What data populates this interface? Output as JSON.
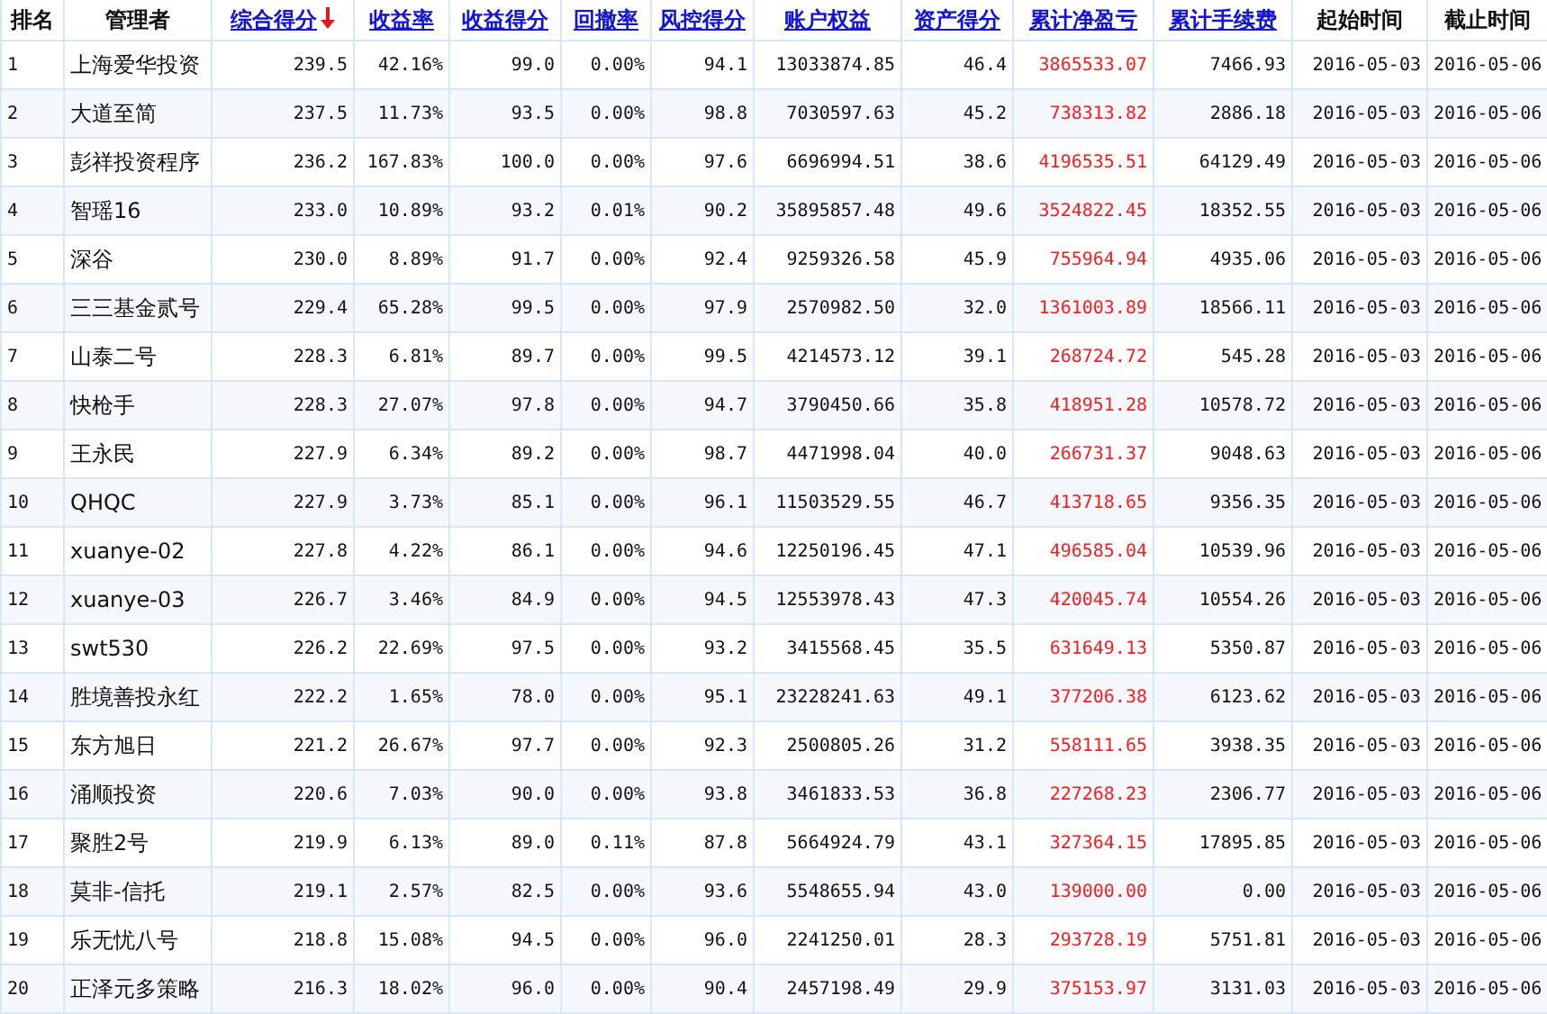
{
  "table": {
    "columns": [
      {
        "label": "排名",
        "sortable": false,
        "sorted": false,
        "negative_red": false
      },
      {
        "label": "管理者",
        "sortable": false,
        "sorted": false,
        "negative_red": false
      },
      {
        "label": "综合得分",
        "sortable": true,
        "sorted": true,
        "negative_red": false
      },
      {
        "label": "收益率",
        "sortable": true,
        "sorted": false,
        "negative_red": false
      },
      {
        "label": "收益得分",
        "sortable": true,
        "sorted": false,
        "negative_red": false
      },
      {
        "label": "回撤率",
        "sortable": true,
        "sorted": false,
        "negative_red": false
      },
      {
        "label": "风控得分",
        "sortable": true,
        "sorted": false,
        "negative_red": false
      },
      {
        "label": "账户权益",
        "sortable": true,
        "sorted": false,
        "negative_red": false
      },
      {
        "label": "资产得分",
        "sortable": true,
        "sorted": false,
        "negative_red": false
      },
      {
        "label": "累计净盈亏",
        "sortable": true,
        "sorted": false,
        "negative_red": true
      },
      {
        "label": "累计手续费",
        "sortable": true,
        "sorted": false,
        "negative_red": false
      },
      {
        "label": "起始时间",
        "sortable": false,
        "sorted": false,
        "negative_red": false
      },
      {
        "label": "截止时间",
        "sortable": false,
        "sorted": false,
        "negative_red": false
      }
    ],
    "rows": [
      [
        "1",
        "上海爱华投资",
        "239.5",
        "42.16%",
        "99.0",
        "0.00%",
        "94.1",
        "13033874.85",
        "46.4",
        "3865533.07",
        "7466.93",
        "2016-05-03",
        "2016-05-06"
      ],
      [
        "2",
        "大道至简",
        "237.5",
        "11.73%",
        "93.5",
        "0.00%",
        "98.8",
        "7030597.63",
        "45.2",
        "738313.82",
        "2886.18",
        "2016-05-03",
        "2016-05-06"
      ],
      [
        "3",
        "彭祥投资程序",
        "236.2",
        "167.83%",
        "100.0",
        "0.00%",
        "97.6",
        "6696994.51",
        "38.6",
        "4196535.51",
        "64129.49",
        "2016-05-03",
        "2016-05-06"
      ],
      [
        "4",
        "智瑶16",
        "233.0",
        "10.89%",
        "93.2",
        "0.01%",
        "90.2",
        "35895857.48",
        "49.6",
        "3524822.45",
        "18352.55",
        "2016-05-03",
        "2016-05-06"
      ],
      [
        "5",
        "深谷",
        "230.0",
        "8.89%",
        "91.7",
        "0.00%",
        "92.4",
        "9259326.58",
        "45.9",
        "755964.94",
        "4935.06",
        "2016-05-03",
        "2016-05-06"
      ],
      [
        "6",
        "三三基金贰号",
        "229.4",
        "65.28%",
        "99.5",
        "0.00%",
        "97.9",
        "2570982.50",
        "32.0",
        "1361003.89",
        "18566.11",
        "2016-05-03",
        "2016-05-06"
      ],
      [
        "7",
        "山泰二号",
        "228.3",
        "6.81%",
        "89.7",
        "0.00%",
        "99.5",
        "4214573.12",
        "39.1",
        "268724.72",
        "545.28",
        "2016-05-03",
        "2016-05-06"
      ],
      [
        "8",
        "快枪手",
        "228.3",
        "27.07%",
        "97.8",
        "0.00%",
        "94.7",
        "3790450.66",
        "35.8",
        "418951.28",
        "10578.72",
        "2016-05-03",
        "2016-05-06"
      ],
      [
        "9",
        "王永民",
        "227.9",
        "6.34%",
        "89.2",
        "0.00%",
        "98.7",
        "4471998.04",
        "40.0",
        "266731.37",
        "9048.63",
        "2016-05-03",
        "2016-05-06"
      ],
      [
        "10",
        "QHQC",
        "227.9",
        "3.73%",
        "85.1",
        "0.00%",
        "96.1",
        "11503529.55",
        "46.7",
        "413718.65",
        "9356.35",
        "2016-05-03",
        "2016-05-06"
      ],
      [
        "11",
        "xuanye-02",
        "227.8",
        "4.22%",
        "86.1",
        "0.00%",
        "94.6",
        "12250196.45",
        "47.1",
        "496585.04",
        "10539.96",
        "2016-05-03",
        "2016-05-06"
      ],
      [
        "12",
        "xuanye-03",
        "226.7",
        "3.46%",
        "84.9",
        "0.00%",
        "94.5",
        "12553978.43",
        "47.3",
        "420045.74",
        "10554.26",
        "2016-05-03",
        "2016-05-06"
      ],
      [
        "13",
        "swt530",
        "226.2",
        "22.69%",
        "97.5",
        "0.00%",
        "93.2",
        "3415568.45",
        "35.5",
        "631649.13",
        "5350.87",
        "2016-05-03",
        "2016-05-06"
      ],
      [
        "14",
        "胜境善投永红",
        "222.2",
        "1.65%",
        "78.0",
        "0.00%",
        "95.1",
        "23228241.63",
        "49.1",
        "377206.38",
        "6123.62",
        "2016-05-03",
        "2016-05-06"
      ],
      [
        "15",
        "东方旭日",
        "221.2",
        "26.67%",
        "97.7",
        "0.00%",
        "92.3",
        "2500805.26",
        "31.2",
        "558111.65",
        "3938.35",
        "2016-05-03",
        "2016-05-06"
      ],
      [
        "16",
        "涌顺投资",
        "220.6",
        "7.03%",
        "90.0",
        "0.00%",
        "93.8",
        "3461833.53",
        "36.8",
        "227268.23",
        "2306.77",
        "2016-05-03",
        "2016-05-06"
      ],
      [
        "17",
        "聚胜2号",
        "219.9",
        "6.13%",
        "89.0",
        "0.11%",
        "87.8",
        "5664924.79",
        "43.1",
        "327364.15",
        "17895.85",
        "2016-05-03",
        "2016-05-06"
      ],
      [
        "18",
        "莫非-信托",
        "219.1",
        "2.57%",
        "82.5",
        "0.00%",
        "93.6",
        "5548655.94",
        "43.0",
        "139000.00",
        "0.00",
        "2016-05-03",
        "2016-05-06"
      ],
      [
        "19",
        "乐无忧八号",
        "218.8",
        "15.08%",
        "94.5",
        "0.00%",
        "96.0",
        "2241250.01",
        "28.3",
        "293728.19",
        "5751.81",
        "2016-05-03",
        "2016-05-06"
      ],
      [
        "20",
        "正泽元多策略",
        "216.3",
        "18.02%",
        "96.0",
        "0.00%",
        "90.4",
        "2457198.49",
        "29.9",
        "375153.97",
        "3131.03",
        "2016-05-03",
        "2016-05-06"
      ]
    ]
  }
}
